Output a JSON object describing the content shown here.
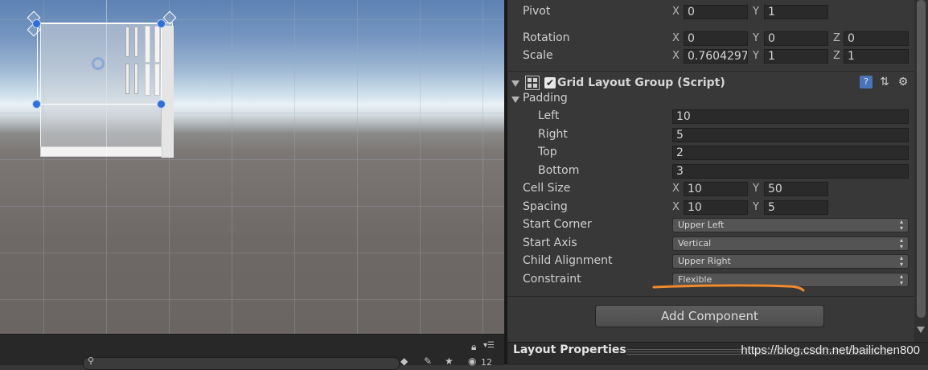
{
  "inspector": {
    "pivot": {
      "label": "Pivot",
      "x_axis": "X",
      "x": "0",
      "y_axis": "Y",
      "y": "1"
    },
    "rotation": {
      "label": "Rotation",
      "x_axis": "X",
      "x": "0",
      "y_axis": "Y",
      "y": "0",
      "z_axis": "Z",
      "z": "0"
    },
    "scale": {
      "label": "Scale",
      "x_axis": "X",
      "x": "0.7604297",
      "y_axis": "Y",
      "y": "1",
      "z_axis": "Z",
      "z": "1"
    },
    "component": {
      "title": "Grid Layout Group (Script)",
      "enabled_mark": "✔",
      "padding": {
        "label": "Padding",
        "left_label": "Left",
        "left": "10",
        "right_label": "Right",
        "right": "5",
        "top_label": "Top",
        "top": "2",
        "bottom_label": "Bottom",
        "bottom": "3"
      },
      "cell_size": {
        "label": "Cell Size",
        "x_axis": "X",
        "x": "10",
        "y_axis": "Y",
        "y": "50"
      },
      "spacing": {
        "label": "Spacing",
        "x_axis": "X",
        "x": "10",
        "y_axis": "Y",
        "y": "5"
      },
      "start_corner": {
        "label": "Start Corner",
        "value": "Upper Left"
      },
      "start_axis": {
        "label": "Start Axis",
        "value": "Vertical"
      },
      "child_alignment": {
        "label": "Child Alignment",
        "value": "Upper Right"
      },
      "constraint": {
        "label": "Constraint",
        "value": "Flexible"
      },
      "header_icons": [
        "help-book-icon",
        "preset-icon",
        "gear-icon"
      ]
    },
    "add_component_label": "Add Component"
  },
  "layout_properties": {
    "title": "Layout Properties"
  },
  "watermark": "https://blog.csdn.net/bailichen800",
  "scene_toolbar": {
    "icons": [
      "search-icon",
      "lock-icon",
      "menu-icon",
      "layers-icon",
      "tag-icon",
      "star-icon",
      "visibility-icon"
    ],
    "hidden_count": "12"
  },
  "colors": {
    "annotation": "#f08a2c",
    "selection_handle": "#2f6fd6"
  }
}
